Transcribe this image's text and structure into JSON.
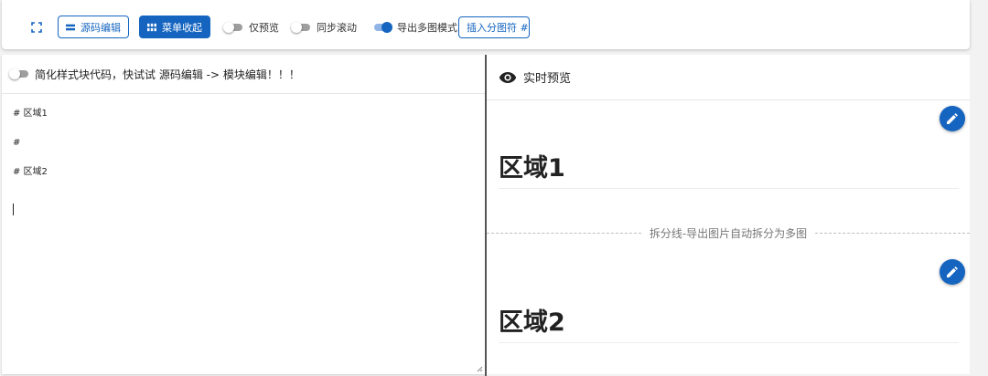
{
  "toolbar": {
    "fullscreen_icon": "fullscreen-icon",
    "source_edit_label": "源码编辑",
    "menu_collapse_label": "菜单收起",
    "preview_only_label": "仅预览",
    "preview_only_on": false,
    "sync_scroll_label": "同步滚动",
    "sync_scroll_on": false,
    "export_multi_label": "导出多图模式",
    "export_multi_on": true,
    "insert_separator_label": "插入分图符 #",
    "accent_color": "#1565c0"
  },
  "editor": {
    "simplify_toggle_on": false,
    "simplify_label": "简化样式块代码，快试试 源码编辑 -> 模块编辑！！！",
    "lines": [
      "# 区域1",
      "",
      "#",
      "",
      "# 区域2"
    ]
  },
  "preview": {
    "title": "实时预览",
    "sections": [
      {
        "heading": "区域1"
      },
      {
        "heading": "区域2"
      }
    ],
    "separator_text": "拆分线-导出图片自动拆分为多图"
  }
}
